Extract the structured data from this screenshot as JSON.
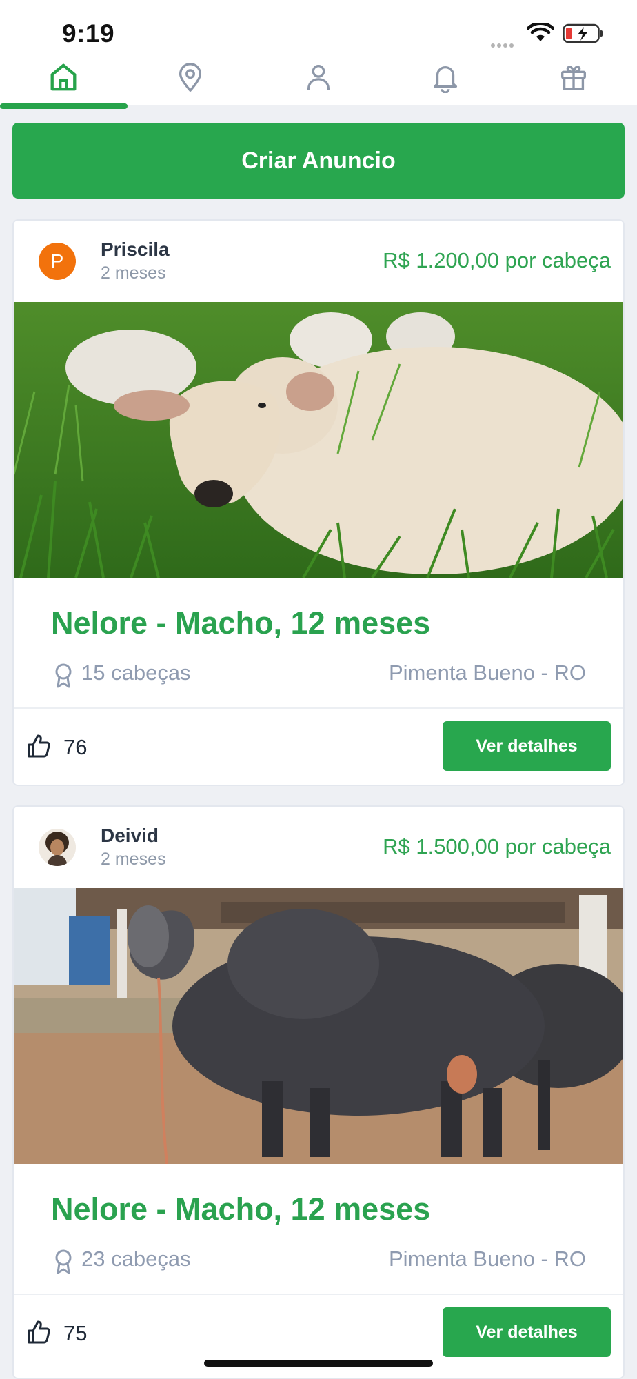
{
  "status_bar": {
    "time": "9:19"
  },
  "tabs": [
    {
      "icon": "home-icon",
      "active": true
    },
    {
      "icon": "location-pin-icon",
      "active": false
    },
    {
      "icon": "user-icon",
      "active": false
    },
    {
      "icon": "bell-icon",
      "active": false
    },
    {
      "icon": "gift-icon",
      "active": false
    }
  ],
  "create_button": {
    "label": "Criar Anuncio"
  },
  "listings": [
    {
      "user": "Priscila",
      "avatar_initial": "P",
      "age": "2 meses",
      "price": "R$ 1.200,00 por cabeça",
      "title": "Nelore - Macho, 12 meses",
      "heads": "15 cabeças",
      "location": "Pimenta Bueno - RO",
      "likes": "76",
      "details_label": "Ver detalhes"
    },
    {
      "user": "Deivid",
      "age": "2 meses",
      "price": "R$ 1.500,00 por cabeça",
      "title": "Nelore - Macho, 12 meses",
      "heads": "23 cabeças",
      "location": "Pimenta Bueno - RO",
      "likes": "75",
      "details_label": "Ver detalhes"
    }
  ],
  "colors": {
    "brand_green": "#28a74e",
    "text_muted": "#8f9bb0",
    "avatar_orange": "#f2720c"
  }
}
